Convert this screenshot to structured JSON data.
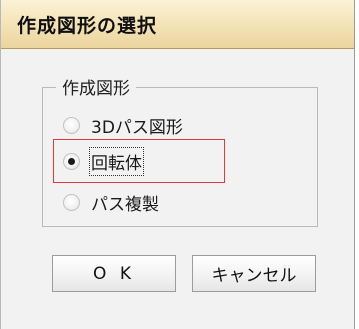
{
  "dialog": {
    "title": "作成図形の選択",
    "group_label": "作成図形",
    "options": [
      {
        "label": "3Dパス図形",
        "selected": false
      },
      {
        "label": "回転体",
        "selected": true
      },
      {
        "label": "パス複製",
        "selected": false
      }
    ],
    "ok_label": "O K",
    "cancel_label": "キャンセル"
  },
  "colors": {
    "title_gradient": "#f3e2b4",
    "dialog_bg": "#f2f2f2",
    "highlight": "#e0393e"
  }
}
